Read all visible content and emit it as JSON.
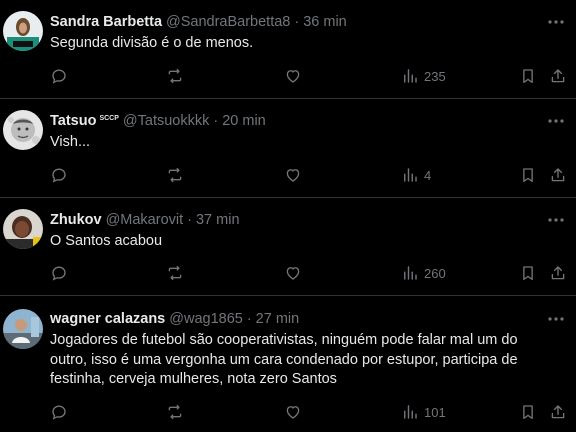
{
  "tweets": [
    {
      "name": "Sandra Barbetta",
      "badge": "",
      "handle": "@SandraBarbetta8",
      "separator": "·",
      "time": "36 min",
      "text": "Segunda divisão é o de menos.",
      "views": "235"
    },
    {
      "name": "Tatsuo",
      "badge": "SCCP",
      "handle": "@Tatsuokkkk",
      "separator": "·",
      "time": "20 min",
      "text": "Vish...",
      "views": "4"
    },
    {
      "name": "Zhukov",
      "badge": "",
      "handle": "@Makarovit",
      "separator": "·",
      "time": "37 min",
      "text": "O Santos acabou",
      "views": "260"
    },
    {
      "name": "wagner calazans",
      "badge": "",
      "handle": "@wag1865",
      "separator": "·",
      "time": "27 min",
      "text": "Jogadores de futebol são cooperativistas, ninguém pode falar mal um do outro, isso é uma vergonha um cara condenado por estupor, participa de festinha, cerveja mulheres,  nota zero Santos",
      "views": "101"
    }
  ],
  "colors": {
    "background": "#000000",
    "text": "#e7e9ea",
    "secondary": "#71767b",
    "divider": "#2f3336"
  }
}
